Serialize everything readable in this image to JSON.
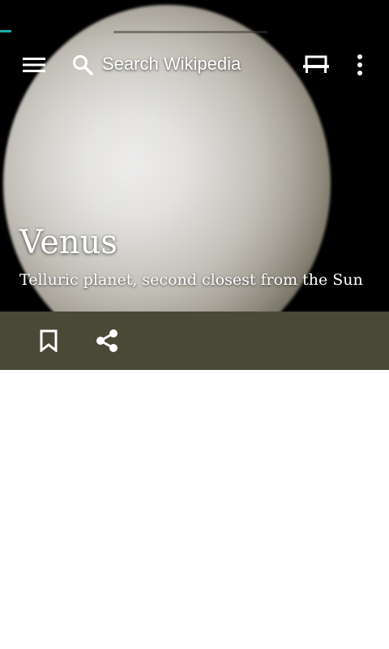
{
  "toolbar": {
    "search_placeholder": "Search Wikipedia",
    "icons": [
      "menu-icon",
      "search-icon",
      "reading-list-icon",
      "more-vert-icon"
    ]
  },
  "article": {
    "title": "Venus",
    "description": "Telluric planet, second closest from the Sun"
  },
  "actions": {
    "icons": [
      "bookmark-icon",
      "share-icon"
    ]
  },
  "load_progress": 0.03,
  "colors": {
    "accent": "#19b0a6",
    "action_bar": "#4a4937",
    "text": "#ffffff"
  }
}
